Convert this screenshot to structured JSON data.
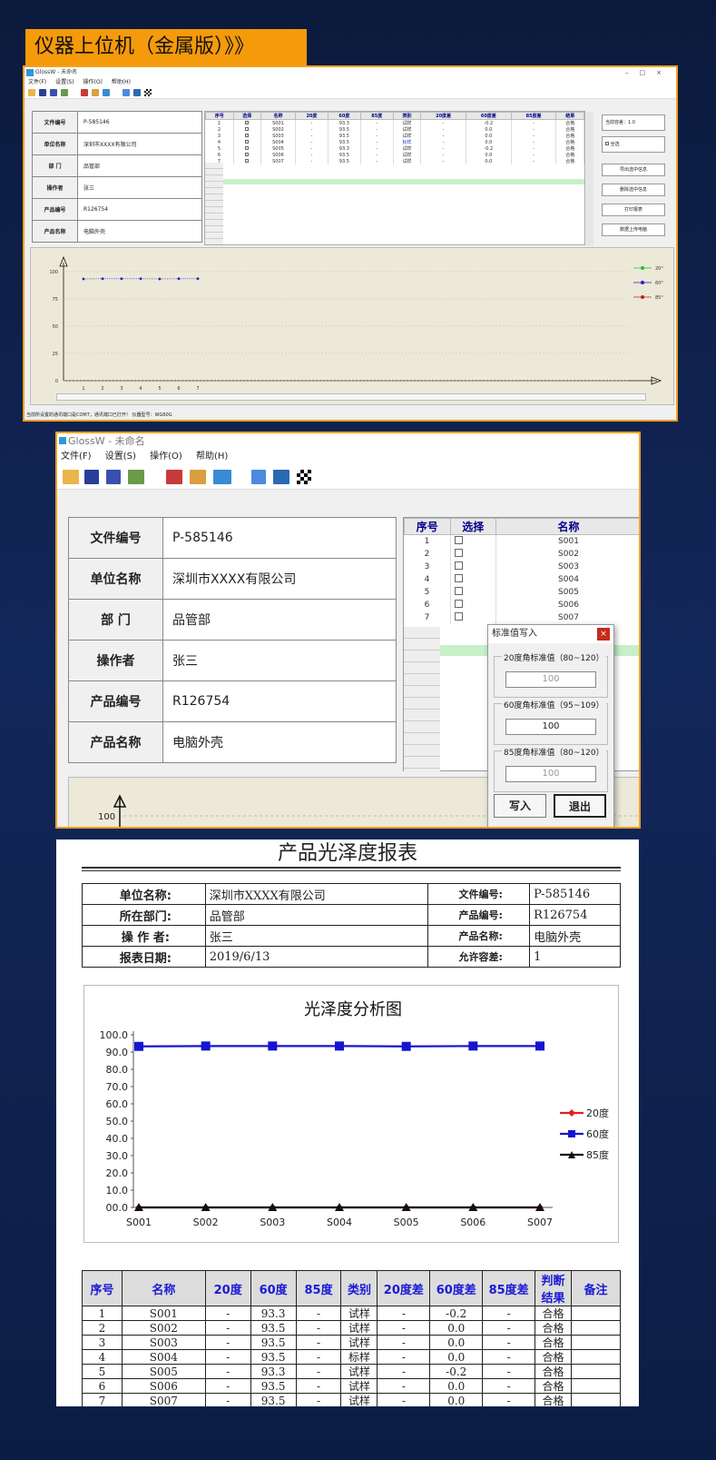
{
  "banner": {
    "title": "仪器上位机（金属版）》》"
  },
  "window1": {
    "title": "GlossW - 未命名",
    "menu": [
      "文件(F)",
      "设置(S)",
      "操作(O)",
      "帮助(H)"
    ],
    "info": [
      {
        "key": "文件编号",
        "value": "P-585146"
      },
      {
        "key": "单位名称",
        "value": "深圳市XXXX有限公司"
      },
      {
        "key": "部 门",
        "value": "品管部"
      },
      {
        "key": "操作者",
        "value": "张三"
      },
      {
        "key": "产品编号",
        "value": "R126754"
      },
      {
        "key": "产品名称",
        "value": "电脑外壳"
      }
    ],
    "grid_headers": [
      "序号",
      "选择",
      "名称",
      "20度",
      "60度",
      "85度",
      "类别",
      "20度差",
      "60度差",
      "85度差",
      "结果"
    ],
    "grid_rows": [
      [
        "1",
        "",
        "S001",
        "-",
        "93.3",
        "-",
        "试样",
        "-",
        "-0.2",
        "-",
        "合格"
      ],
      [
        "2",
        "",
        "S002",
        "-",
        "93.5",
        "-",
        "试样",
        "-",
        "0.0",
        "-",
        "合格"
      ],
      [
        "3",
        "",
        "S003",
        "-",
        "93.5",
        "-",
        "试样",
        "-",
        "0.0",
        "-",
        "合格"
      ],
      [
        "4",
        "",
        "S004",
        "-",
        "93.5",
        "-",
        "标样",
        "-",
        "0.0",
        "-",
        "合格"
      ],
      [
        "5",
        "",
        "S005",
        "-",
        "93.3",
        "-",
        "试样",
        "-",
        "-0.2",
        "-",
        "合格"
      ],
      [
        "6",
        "",
        "S006",
        "-",
        "93.5",
        "-",
        "试样",
        "-",
        "0.0",
        "-",
        "合格"
      ],
      [
        "7",
        "",
        "S007",
        "-",
        "93.5",
        "-",
        "试样",
        "-",
        "0.0",
        "-",
        "合格"
      ]
    ],
    "tolerance_label": "当前容差：1.0",
    "select_all": "全选",
    "buttons": [
      "导出选中信息",
      "删除选中信息",
      "打印报表",
      "数据上传电脑"
    ],
    "status": "当前所设置的通讯端口是COM7，通讯端口已打开！  仪器型号：WG60G",
    "chart": {
      "y_ticks": [
        "100",
        "75",
        "50",
        "25",
        "0"
      ],
      "x_ticks": [
        "1",
        "2",
        "3",
        "4",
        "5",
        "6",
        "7"
      ],
      "legend": [
        "20°",
        "60°",
        "85°"
      ],
      "values60": [
        93.3,
        93.5,
        93.5,
        93.5,
        93.3,
        93.5,
        93.5
      ]
    }
  },
  "window2": {
    "title": "GlossW - 未命名",
    "menu": [
      "文件(F)",
      "设置(S)",
      "操作(O)",
      "帮助(H)"
    ],
    "info": [
      {
        "key": "文件编号",
        "value": "P-585146"
      },
      {
        "key": "单位名称",
        "value": "深圳市XXXX有限公司"
      },
      {
        "key": "部 门",
        "value": "品管部"
      },
      {
        "key": "操作者",
        "value": "张三"
      },
      {
        "key": "产品编号",
        "value": "R126754"
      },
      {
        "key": "产品名称",
        "value": "电脑外壳"
      }
    ],
    "grid_headers": [
      "序号",
      "选择",
      "名称"
    ],
    "grid_rows": [
      [
        "1",
        "S001"
      ],
      [
        "2",
        "S002"
      ],
      [
        "3",
        "S003"
      ],
      [
        "4",
        "S004"
      ],
      [
        "5",
        "S005"
      ],
      [
        "6",
        "S006"
      ],
      [
        "7",
        "S007"
      ]
    ],
    "chart_tick": "100",
    "dialog": {
      "title": "标准值写入",
      "close": "×",
      "groups": [
        {
          "label": "20度角标准值（80~120）",
          "value": "100"
        },
        {
          "label": "60度角标准值（95~109）",
          "value": "100"
        },
        {
          "label": "85度角标准值（80~120）",
          "value": "100"
        }
      ],
      "write_button": "写入",
      "exit_button": "退出"
    }
  },
  "report": {
    "title": "产品光泽度报表",
    "info": [
      [
        "单位名称:",
        "深圳市XXXX有限公司",
        "文件编号:",
        "P-585146"
      ],
      [
        "所在部门:",
        "品管部",
        "产品编号:",
        "R126754"
      ],
      [
        "操 作 者:",
        "张三",
        "产品名称:",
        "电脑外壳"
      ],
      [
        "报表日期:",
        "2019/6/13",
        "允许容差:",
        "1"
      ]
    ],
    "table_headers": [
      "序号",
      "名称",
      "20度",
      "60度",
      "85度",
      "类别",
      "20度差",
      "60度差",
      "85度差",
      "判断结果",
      "备注"
    ],
    "table_rows": [
      [
        "1",
        "S001",
        "-",
        "93.3",
        "-",
        "试样",
        "-",
        "-0.2",
        "-",
        "合格",
        ""
      ],
      [
        "2",
        "S002",
        "-",
        "93.5",
        "-",
        "试样",
        "-",
        "0.0",
        "-",
        "合格",
        ""
      ],
      [
        "3",
        "S003",
        "-",
        "93.5",
        "-",
        "试样",
        "-",
        "0.0",
        "-",
        "合格",
        ""
      ],
      [
        "4",
        "S004",
        "-",
        "93.5",
        "-",
        "标样",
        "-",
        "0.0",
        "-",
        "合格",
        ""
      ],
      [
        "5",
        "S005",
        "-",
        "93.3",
        "-",
        "试样",
        "-",
        "-0.2",
        "-",
        "合格",
        ""
      ],
      [
        "6",
        "S006",
        "-",
        "93.5",
        "-",
        "试样",
        "-",
        "0.0",
        "-",
        "合格",
        ""
      ],
      [
        "7",
        "S007",
        "-",
        "93.5",
        "-",
        "试样",
        "-",
        "0.0",
        "-",
        "合格",
        ""
      ]
    ]
  },
  "chart_data": {
    "type": "line",
    "title": "光泽度分析图",
    "categories": [
      "S001",
      "S002",
      "S003",
      "S004",
      "S005",
      "S006",
      "S007"
    ],
    "series": [
      {
        "name": "20度",
        "values": [
          0,
          0,
          0,
          0,
          0,
          0,
          0
        ],
        "color": "#e02020"
      },
      {
        "name": "60度",
        "values": [
          93.3,
          93.5,
          93.5,
          93.5,
          93.3,
          93.5,
          93.5
        ],
        "color": "#1515d0"
      },
      {
        "name": "85度",
        "values": [
          0,
          0,
          0,
          0,
          0,
          0,
          0
        ],
        "color": "#111111"
      }
    ],
    "ylim": [
      0,
      100
    ],
    "y_ticks": [
      "100.0",
      "90.0",
      "80.0",
      "70.0",
      "60.0",
      "50.0",
      "40.0",
      "30.0",
      "20.0",
      "10.0",
      "00.0"
    ],
    "legend": "right"
  }
}
